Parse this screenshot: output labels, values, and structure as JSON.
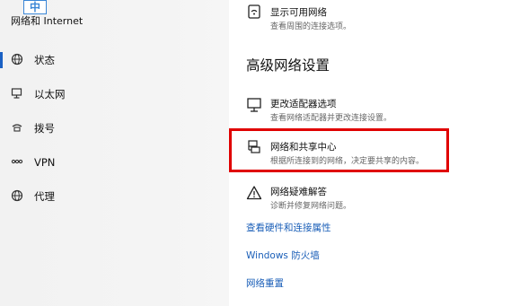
{
  "ime_indicator": "中",
  "sidebar": {
    "title": "网络和 Internet",
    "items": [
      {
        "label": "状态",
        "icon": "globe-icon"
      },
      {
        "label": "以太网",
        "icon": "monitor-icon"
      },
      {
        "label": "拨号",
        "icon": "phone-icon"
      },
      {
        "label": "VPN",
        "icon": "vpn-icon"
      },
      {
        "label": "代理",
        "icon": "globe-icon"
      }
    ]
  },
  "main": {
    "show_networks": {
      "title": "显示可用网络",
      "desc": "查看周围的连接选项。"
    },
    "section_title": "高级网络设置",
    "adapter_options": {
      "title": "更改适配器选项",
      "desc": "查看网络适配器并更改连接设置。"
    },
    "sharing_center": {
      "title": "网络和共享中心",
      "desc": "根据所连接到的网络，决定要共享的内容。"
    },
    "troubleshooter": {
      "title": "网络疑难解答",
      "desc": "诊断并修复网络问题。"
    },
    "links": {
      "hardware": "查看硬件和连接属性",
      "firewall": "Windows 防火墙",
      "reset": "网络重置"
    }
  },
  "colors": {
    "accent": "#1b61c4",
    "link": "#1b5fb8",
    "highlight_border": "#e00000"
  }
}
